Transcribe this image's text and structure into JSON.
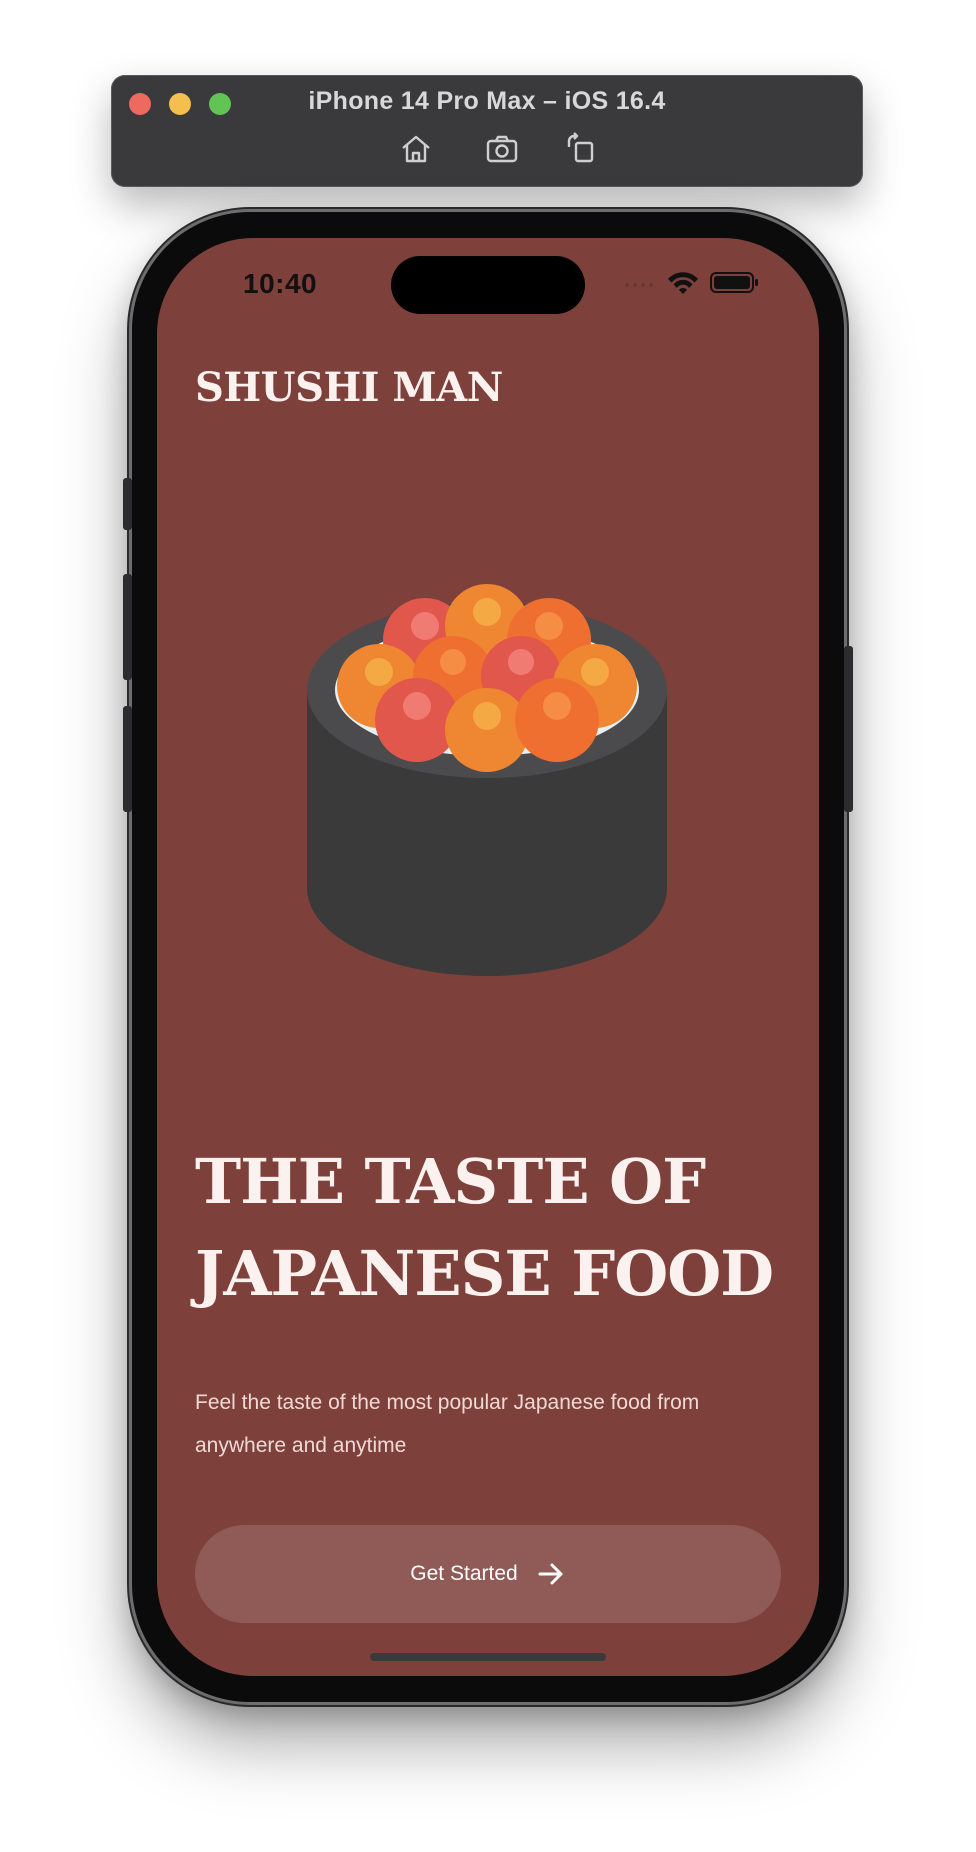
{
  "simulator": {
    "title": "iPhone 14 Pro Max – iOS 16.4",
    "toolbar": [
      {
        "icon": "home-icon"
      },
      {
        "icon": "screenshot-icon"
      },
      {
        "icon": "rotate-icon"
      }
    ]
  },
  "status_bar": {
    "time": "10:40",
    "icons": [
      "cellular-icon",
      "wifi-icon",
      "battery-icon"
    ]
  },
  "app": {
    "brand": "SHUSHI MAN",
    "hero_image": "sushi-roll-illustration",
    "headline_line1": "THE TASTE OF",
    "headline_line2": "JAPANESE FOOD",
    "subtitle": "Feel the taste of the most popular Japanese food from anywhere and anytime",
    "cta_label": "Get Started",
    "cta_icon": "arrow-right-icon"
  },
  "colors": {
    "background": "#7e403b",
    "text_primary": "#fbf2ef",
    "button_bg": "rgba(255,255,255,0.14)"
  }
}
